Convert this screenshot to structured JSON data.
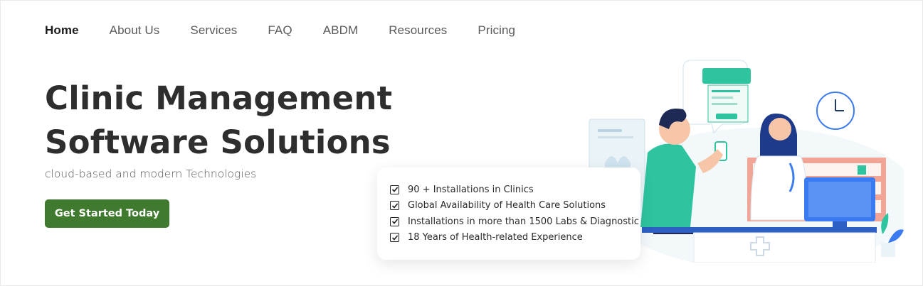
{
  "nav": {
    "items": [
      {
        "label": "Home",
        "active": true
      },
      {
        "label": "About Us"
      },
      {
        "label": "Services"
      },
      {
        "label": "FAQ"
      },
      {
        "label": "ABDM"
      },
      {
        "label": "Resources"
      },
      {
        "label": "Pricing"
      }
    ]
  },
  "hero": {
    "title_line1": "Clinic Management",
    "title_line2": "Software Solutions",
    "subtitle": "cloud-based and modern Technologies",
    "cta_label": "Get Started Today"
  },
  "features": [
    "90 + Installations in Clinics",
    "Global Availability of Health Care Solutions",
    "Installations in more than 1500 Labs & Diagnostic",
    "18 Years of Health-related Experience"
  ],
  "colors": {
    "cta": "#3f7a2f",
    "accent_teal": "#2ec4a0",
    "accent_blue": "#3a7bf2"
  },
  "icons": [
    "checkbox-checked-icon",
    "clock-icon",
    "monitor-icon",
    "phone-icon"
  ]
}
